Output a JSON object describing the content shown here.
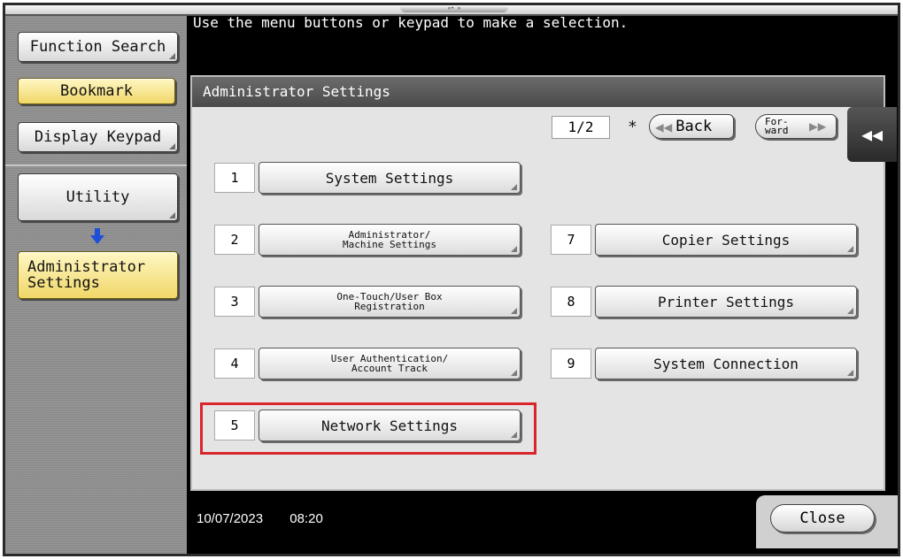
{
  "top": {
    "notch_label": "«• »"
  },
  "left": {
    "function_search": "Function Search",
    "bookmark": "Bookmark",
    "display_keypad": "Display Keypad",
    "utility": "Utility",
    "admin_line1": "Administrator",
    "admin_line2": "Settings"
  },
  "message": "Use the menu buttons or keypad to make a selection.",
  "panel": {
    "title": "Administrator Settings",
    "page_indicator": "1/2",
    "star": "*",
    "back_label": "Back",
    "forward_line1": "For-",
    "forward_line2": "ward",
    "collapse_glyph": "◀◀"
  },
  "items": [
    {
      "num": "1",
      "label": "System Settings"
    },
    {
      "num": "2",
      "label_line1": "Administrator/",
      "label_line2": "Machine Settings"
    },
    {
      "num": "3",
      "label_line1": "One-Touch/User Box",
      "label_line2": "Registration"
    },
    {
      "num": "4",
      "label_line1": "User Authentication/",
      "label_line2": "Account Track"
    },
    {
      "num": "5",
      "label": "Network Settings"
    },
    {
      "num": "7",
      "label": "Copier Settings"
    },
    {
      "num": "8",
      "label": "Printer Settings"
    },
    {
      "num": "9",
      "label": "System Connection"
    }
  ],
  "bottom": {
    "date": "10/07/2023",
    "time": "08:20",
    "close": "Close"
  },
  "colors": {
    "highlight": "#d9262c",
    "yellow_button": "#f0d768",
    "panel_header": "#4a4a4a"
  }
}
